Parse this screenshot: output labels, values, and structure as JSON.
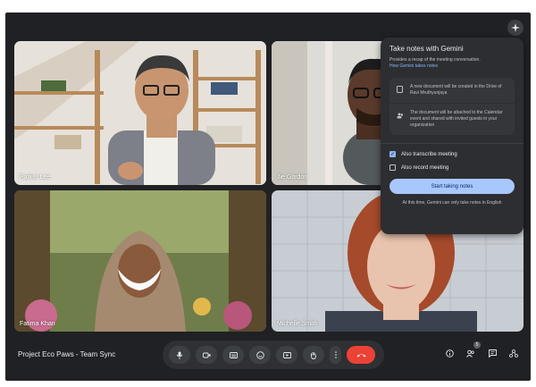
{
  "meeting": {
    "title": "Project Eco Paws - Team Sync"
  },
  "participants": [
    {
      "name": "Parker Lee"
    },
    {
      "name": "Jie Gordon"
    },
    {
      "name": "Fatima Khan"
    },
    {
      "name": "Michelle Smith"
    }
  ],
  "gemini_panel": {
    "title": "Take notes with Gemini",
    "subtitle": "Provides a recap of the meeting conversation.",
    "link": "How Gemini takes notes",
    "info_doc": "A new document will be created in the Drive of Ravi Mruthyunjaya",
    "info_share": "The document will be attached to the Calendar event and shared with invited guests in your organization",
    "option_transcribe": {
      "label": "Also transcribe meeting",
      "checked": true
    },
    "option_record": {
      "label": "Also record meeting",
      "checked": false
    },
    "start_button": "Start taking notes",
    "footnote": "At this time, Gemini can only take notes in English"
  },
  "people_count": "5",
  "colors": {
    "background": "#202124",
    "panel": "#2d2e31",
    "accent": "#a8c7fa",
    "end_call": "#ea4335",
    "speaker_outline": "#8ab4f8"
  },
  "icons": [
    "sparkle-icon",
    "mic-icon",
    "camera-icon",
    "captions-icon",
    "emoji-icon",
    "present-icon",
    "raise-hand-icon",
    "more-icon",
    "end-call-icon",
    "info-icon",
    "people-icon",
    "chat-icon",
    "activities-icon",
    "document-icon",
    "share-icon"
  ]
}
